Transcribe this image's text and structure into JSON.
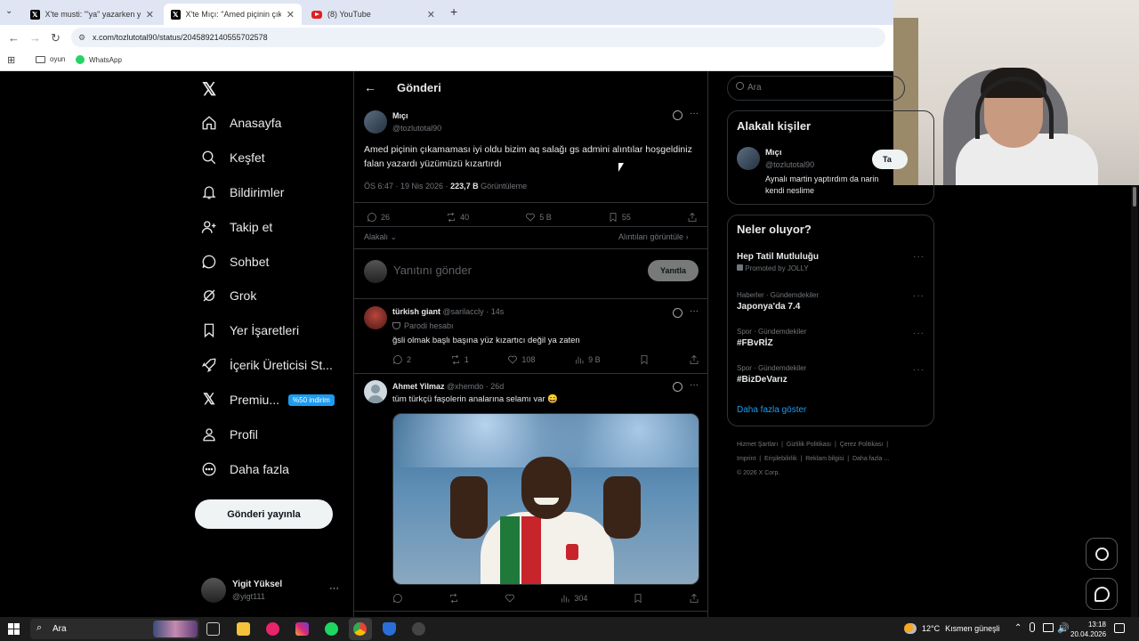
{
  "browser": {
    "tabs": [
      {
        "title": "X'te musti: \"'ya\" yazarken yanlış",
        "icon": "x-logo-icon"
      },
      {
        "title": "X'te Mıçı: \"Amed piçinin çıkama",
        "icon": "x-logo-icon"
      },
      {
        "title": "(8) YouTube",
        "icon": "youtube-icon"
      }
    ],
    "url": "x.com/tozlutotal90/status/2045892140555702578",
    "bookmarks": [
      {
        "label": "oyun",
        "icon": "folder-icon"
      },
      {
        "label": "WhatsApp",
        "icon": "whatsapp-icon"
      }
    ]
  },
  "sidebar": {
    "items": [
      {
        "label": "Anasayfa",
        "icon": "home-icon"
      },
      {
        "label": "Keşfet",
        "icon": "search-icon"
      },
      {
        "label": "Bildirimler",
        "icon": "bell-icon"
      },
      {
        "label": "Takip et",
        "icon": "person-add-icon"
      },
      {
        "label": "Sohbet",
        "icon": "chat-icon"
      },
      {
        "label": "Grok",
        "icon": "grok-icon"
      },
      {
        "label": "Yer İşaretleri",
        "icon": "bookmark-icon"
      },
      {
        "label": "İçerik Üreticisi St...",
        "icon": "rocket-icon"
      },
      {
        "label": "Premiu...",
        "icon": "x-logo-icon",
        "badge": "%50 indirim"
      },
      {
        "label": "Profil",
        "icon": "profile-icon"
      },
      {
        "label": "Daha fazla",
        "icon": "more-circle-icon"
      }
    ],
    "post_button": "Gönderi yayınla",
    "account": {
      "name": "Yigit Yüksel",
      "handle": "@yigt111"
    }
  },
  "header": {
    "title": "Gönderi"
  },
  "main_post": {
    "name": "Mıçı",
    "handle": "@tozlutotal90",
    "text": "Amed piçinin çıkamaması iyi oldu bizim aq salağı gs admini alıntılar hoşgeldiniz falan yazardı yüzümüzü kızartırdı",
    "time": "ÖS 6:47 · 19 Nis 2026 ·",
    "views": "223,7 B",
    "views_label": "Görüntüleme",
    "replies": "26",
    "reposts": "40",
    "likes": "5 B",
    "bookmarks": "55",
    "relevant": "Alakalı",
    "quotes_link": "Alıntıları görüntüle"
  },
  "reply_box": {
    "placeholder": "Yanıtını gönder",
    "button": "Yanıtla"
  },
  "replies": [
    {
      "name": "türkish giant",
      "handle": "@sarilaccly",
      "age": "· 14s",
      "label": "Parodi hesabı",
      "text": "ğsli olmak başlı başına yüz kızartıcı değil ya zaten",
      "replies": "2",
      "reposts": "1",
      "likes": "108",
      "views": "9 B"
    },
    {
      "name": "Ahmet Yilmaz",
      "handle": "@xhemdo",
      "age": "· 26d",
      "text": "tüm türkçü faşolerin analarına selamı var 😄",
      "views": "304"
    }
  ],
  "search": {
    "placeholder": "Ara"
  },
  "relevant_people": {
    "title": "Alakalı kişiler",
    "person": {
      "name": "Mıçı",
      "handle": "@tozlutotal90",
      "bio": "Aynalı martin yaptırdım da narin kendi neslime",
      "button": "Ta"
    }
  },
  "trends": {
    "title": "Neler oluyor?",
    "items": [
      {
        "meta": "Promoted by JOLLY",
        "name": "Hep Tatil Mutluluğu"
      },
      {
        "meta": "Haberler · Gündemdekiler",
        "name": "Japonya'da 7.4"
      },
      {
        "meta": "Spor · Gündemdekiler",
        "name": "#FBvRİZ"
      },
      {
        "meta": "Spor · Gündemdekiler",
        "name": "#BizDeVarız"
      }
    ],
    "more": "Daha fazla göster"
  },
  "footer_links": [
    "Hizmet Şartları",
    "Gizlilik Politikası",
    "Çerez Politikası",
    "Imprint",
    "Erişilebilirlik",
    "Reklam bilgisi",
    "Daha fazla ...",
    "© 2026 X Corp."
  ],
  "taskbar": {
    "search": "Ara",
    "weather": "12°C",
    "weather_text": "Kısmen güneşli",
    "time": "13:18",
    "date": "20.04.2026"
  },
  "colors": {
    "accent": "#1d9bf0",
    "background": "#000000",
    "border": "#2f3336",
    "muted": "#71767b"
  }
}
